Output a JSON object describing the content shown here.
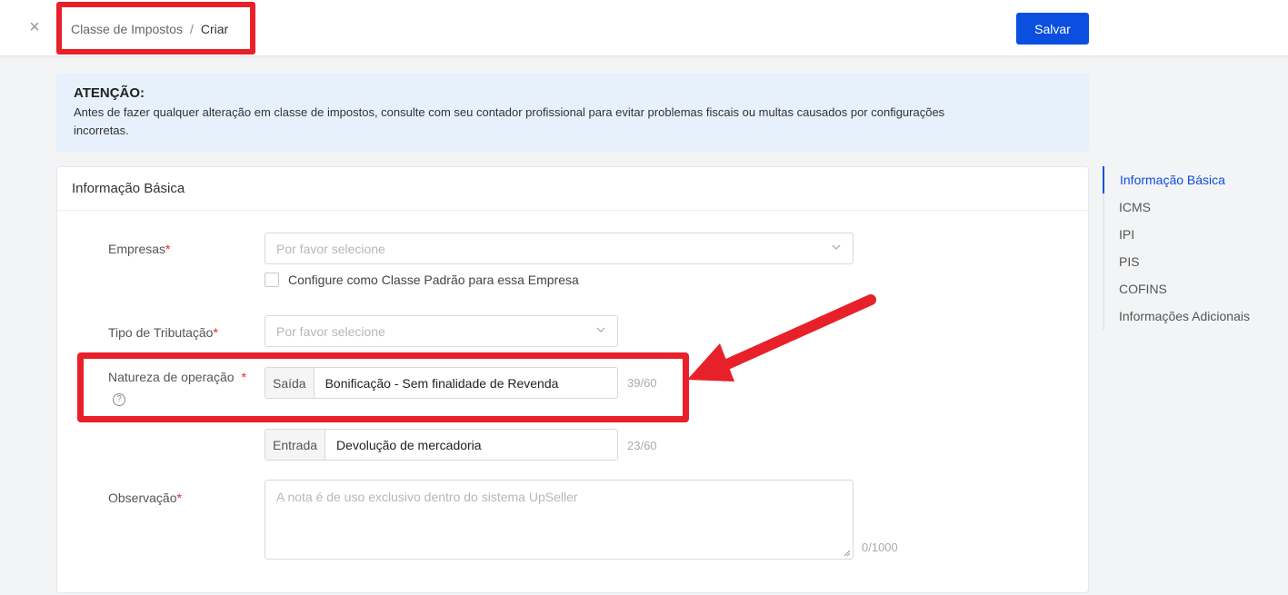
{
  "header": {
    "close_symbol": "×",
    "breadcrumb_parent": "Classe de Impostos",
    "breadcrumb_separator": "/",
    "breadcrumb_current": "Criar",
    "save_label": "Salvar"
  },
  "alert": {
    "title": "ATENÇÃO:",
    "line1": "Antes de fazer qualquer alteração em classe de impostos, consulte com seu contador profissional para evitar problemas fiscais ou multas causados por configurações",
    "line2": "incorretas."
  },
  "section": {
    "title": "Informação Básica"
  },
  "form": {
    "empresas_label": "Empresas",
    "empresas_placeholder": "Por favor selecione",
    "default_class_checkbox": "Configure como Classe Padrão para essa Empresa",
    "tipo_label": "Tipo de Tributação",
    "tipo_placeholder": "Por favor selecione",
    "natureza_label": "Natureza de operação",
    "help_symbol": "?",
    "required_mark": "*",
    "saida_addon": "Saída",
    "saida_value": "Bonificação - Sem finalidade de Revenda",
    "saida_counter": "39/60",
    "entrada_addon": "Entrada",
    "entrada_value": "Devolução de mercadoria",
    "entrada_counter": "23/60",
    "observacao_label": "Observação",
    "observacao_placeholder": "A nota é de uso exclusivo dentro do sistema UpSeller",
    "observacao_counter": "0/1000"
  },
  "anchor_nav": {
    "items": [
      {
        "label": "Informação Básica",
        "active": true
      },
      {
        "label": "ICMS",
        "active": false
      },
      {
        "label": "IPI",
        "active": false
      },
      {
        "label": "PIS",
        "active": false
      },
      {
        "label": "COFINS",
        "active": false
      },
      {
        "label": "Informações Adicionais",
        "active": false
      }
    ]
  },
  "colors": {
    "primary": "#0a4fe0",
    "annotation_red": "#e8202a",
    "alert_bg": "#e6f1fc"
  }
}
